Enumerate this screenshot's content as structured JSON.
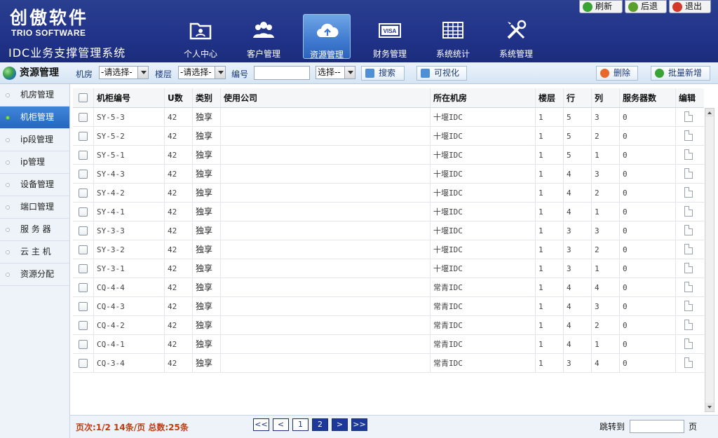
{
  "brand": {
    "name_cn": "创傲软件",
    "name_en": "TRIO SOFTWARE",
    "system_name": "IDC业务支撑管理系统"
  },
  "nav": [
    {
      "label": "个人中心",
      "icon": "folder-user-icon"
    },
    {
      "label": "客户管理",
      "icon": "users-icon"
    },
    {
      "label": "资源管理",
      "icon": "cloud-upload-icon",
      "active": true
    },
    {
      "label": "财务管理",
      "icon": "visa-card-icon"
    },
    {
      "label": "系统统计",
      "icon": "grid-table-icon"
    },
    {
      "label": "系统管理",
      "icon": "tools-icon"
    }
  ],
  "top_buttons": {
    "refresh": "刷新",
    "back": "后退",
    "exit": "退出"
  },
  "toolbar": {
    "module_title": "资源管理",
    "room_label": "机房",
    "room_value": "-请选择-",
    "floor_label": "楼层",
    "floor_value": "-请选择-",
    "number_label": "编号",
    "number_value": "",
    "type_value": "选择--",
    "search_label": "搜索",
    "visualize_label": "可视化",
    "delete_label": "删除",
    "batch_add_label": "批量新增"
  },
  "sidebar": {
    "items": [
      {
        "label": "机房管理"
      },
      {
        "label": "机柜管理",
        "active": true
      },
      {
        "label": "ip段管理"
      },
      {
        "label": "ip管理"
      },
      {
        "label": "设备管理"
      },
      {
        "label": "端口管理"
      },
      {
        "label": "服 务 器"
      },
      {
        "label": "云 主 机"
      },
      {
        "label": "资源分配"
      }
    ]
  },
  "table": {
    "headers": {
      "id": "机柜编号",
      "u": "U数",
      "type": "类别",
      "company": "使用公司",
      "room": "所在机房",
      "floor": "楼层",
      "row": "行",
      "col": "列",
      "servers": "服务器数",
      "edit": "编辑"
    },
    "rows": [
      {
        "id": "SY-5-3",
        "u": "42",
        "type": "独享",
        "company": "",
        "room": "十堰IDC",
        "floor": "1",
        "row": "5",
        "col": "3",
        "servers": "0"
      },
      {
        "id": "SY-5-2",
        "u": "42",
        "type": "独享",
        "company": "",
        "room": "十堰IDC",
        "floor": "1",
        "row": "5",
        "col": "2",
        "servers": "0"
      },
      {
        "id": "SY-5-1",
        "u": "42",
        "type": "独享",
        "company": "",
        "room": "十堰IDC",
        "floor": "1",
        "row": "5",
        "col": "1",
        "servers": "0"
      },
      {
        "id": "SY-4-3",
        "u": "42",
        "type": "独享",
        "company": "",
        "room": "十堰IDC",
        "floor": "1",
        "row": "4",
        "col": "3",
        "servers": "0"
      },
      {
        "id": "SY-4-2",
        "u": "42",
        "type": "独享",
        "company": "",
        "room": "十堰IDC",
        "floor": "1",
        "row": "4",
        "col": "2",
        "servers": "0"
      },
      {
        "id": "SY-4-1",
        "u": "42",
        "type": "独享",
        "company": "",
        "room": "十堰IDC",
        "floor": "1",
        "row": "4",
        "col": "1",
        "servers": "0"
      },
      {
        "id": "SY-3-3",
        "u": "42",
        "type": "独享",
        "company": "",
        "room": "十堰IDC",
        "floor": "1",
        "row": "3",
        "col": "3",
        "servers": "0"
      },
      {
        "id": "SY-3-2",
        "u": "42",
        "type": "独享",
        "company": "",
        "room": "十堰IDC",
        "floor": "1",
        "row": "3",
        "col": "2",
        "servers": "0"
      },
      {
        "id": "SY-3-1",
        "u": "42",
        "type": "独享",
        "company": "",
        "room": "十堰IDC",
        "floor": "1",
        "row": "3",
        "col": "1",
        "servers": "0"
      },
      {
        "id": "CQ-4-4",
        "u": "42",
        "type": "独享",
        "company": "",
        "room": "常青IDC",
        "floor": "1",
        "row": "4",
        "col": "4",
        "servers": "0"
      },
      {
        "id": "CQ-4-3",
        "u": "42",
        "type": "独享",
        "company": "",
        "room": "常青IDC",
        "floor": "1",
        "row": "4",
        "col": "3",
        "servers": "0"
      },
      {
        "id": "CQ-4-2",
        "u": "42",
        "type": "独享",
        "company": "",
        "room": "常青IDC",
        "floor": "1",
        "row": "4",
        "col": "2",
        "servers": "0"
      },
      {
        "id": "CQ-4-1",
        "u": "42",
        "type": "独享",
        "company": "",
        "room": "常青IDC",
        "floor": "1",
        "row": "4",
        "col": "1",
        "servers": "0"
      },
      {
        "id": "CQ-3-4",
        "u": "42",
        "type": "独享",
        "company": "",
        "room": "常青IDC",
        "floor": "1",
        "row": "3",
        "col": "4",
        "servers": "0"
      }
    ]
  },
  "pagination": {
    "info": "页次:1/2 14条/页 总数:25条",
    "first": "<<",
    "prev": "<",
    "page1": "1",
    "page2": "2",
    "next": ">",
    "last": ">>",
    "jump_label": "跳转到",
    "jump_value": "",
    "jump_unit": "页"
  },
  "colors": {
    "header_bg": "#22348a",
    "nav_active": "#3f7ad0",
    "sidebar_active": "#2567c1",
    "page_info": "#c03a10"
  }
}
